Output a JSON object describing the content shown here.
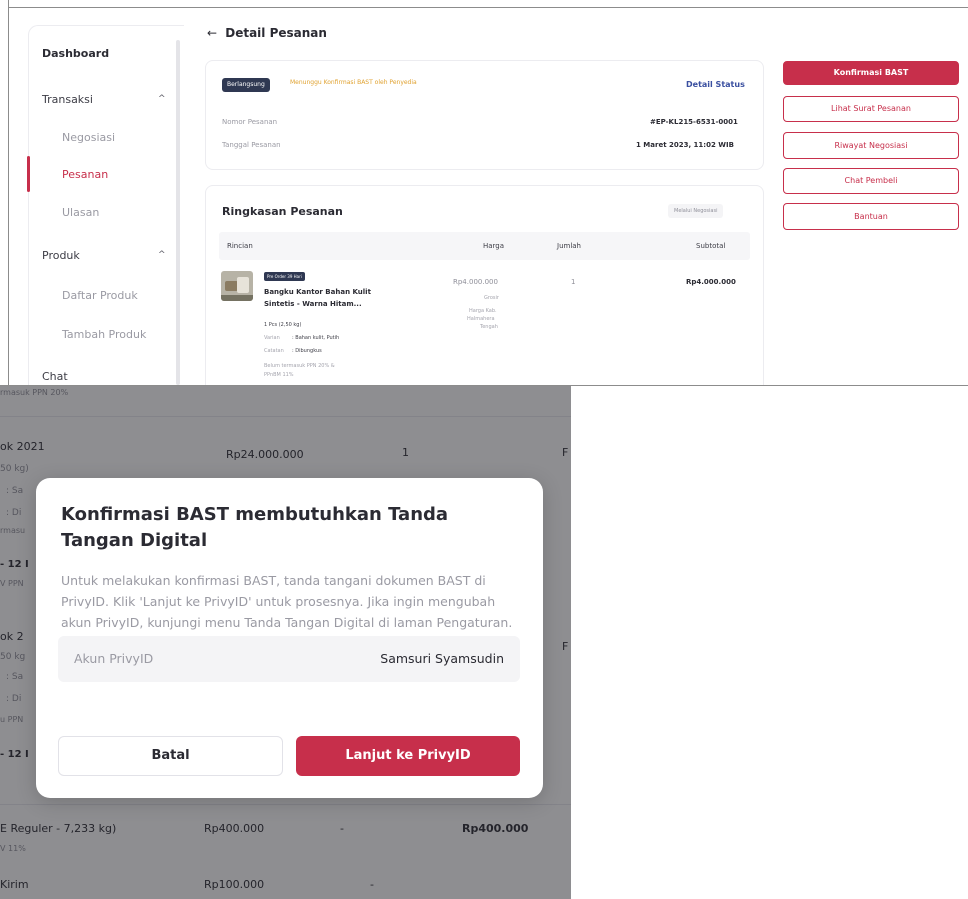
{
  "sidebar": {
    "dashboard": "Dashboard",
    "transaksi": "Transaksi",
    "negosiasi": "Negosiasi",
    "pesanan": "Pesanan",
    "ulasan": "Ulasan",
    "produk": "Produk",
    "daftar_produk": "Daftar Produk",
    "tambah_produk": "Tambah Produk",
    "chat": "Chat",
    "chevron": "^"
  },
  "header": {
    "back_arrow": "←",
    "title": "Detail Pesanan"
  },
  "order": {
    "status_badge": "Berlangsung",
    "status_note": "Menunggu Konfirmasi BAST oleh Penyedia",
    "detail_status_link": "Detail Status",
    "nomor_label": "Nomor Pesanan",
    "nomor_value": "#EP-KL215-6531-0001",
    "tanggal_label": "Tanggal Pesanan",
    "tanggal_value": "1 Maret 2023, 11:02 WIB"
  },
  "summary": {
    "title": "Ringkasan Pesanan",
    "via_badge": "Melalui Negosiasi",
    "columns": {
      "rincian": "Rincian",
      "harga": "Harga",
      "jumlah": "Jumlah",
      "subtotal": "Subtotal"
    },
    "item": {
      "badge": "Pre Order 39 Hari",
      "name_line1": "Bangku Kantor Bahan Kulit",
      "name_line2": "Sintetis - Warna Hitam...",
      "qty_weight": "1 Pcs (2,50 kg)",
      "varian_label": "Varian",
      "varian_value": ": Bahan kulit, Putih",
      "catatan_label": "Catatan",
      "catatan_value": ": Dibungkus",
      "tax_line1": "Belum termasuk PPN 20% &",
      "tax_line2": "PPnBM 11%",
      "price": "Rp4.000.000",
      "grosir": "Grosir",
      "harga_note_1": "Harga Kab.",
      "harga_note_2": "Halmahera",
      "harga_note_3": "Tengah",
      "qty": "1",
      "subtotal": "Rp4.000.000"
    }
  },
  "actions": {
    "konfirmasi": "Konfirmasi BAST",
    "lihat_surat": "Lihat Surat Pesanan",
    "riwayat": "Riwayat Negosiasi",
    "chat": "Chat Pembeli",
    "bantuan": "Bantuan"
  },
  "background_list": {
    "row0_tax": "rmasuk PPN 20%",
    "row1_name": "ok 2021",
    "row1_weight": "50 kg)",
    "row1_price": "Rp24.000.000",
    "row1_qty": "1",
    "row1_s": ": Sa",
    "row1_d": ": Di",
    "row1_tax": "rmasu",
    "row1_12": "- 12 I",
    "row1_ppn": "V PPN",
    "row2_name": "ok 2",
    "row2_weight": "50 kg",
    "row2_s": ": Sa",
    "row2_d": ": Di",
    "row2_ppn": "u PPN",
    "row2_12": "- 12 I",
    "ship_name": "E Reguler - 7,233 kg)",
    "ship_tax": "V 11%",
    "ship_price": "Rp400.000",
    "ship_qty": "-",
    "ship_subtotal": "Rp400.000",
    "kirim_name": "Kirim",
    "kirim_price": "Rp100.000",
    "kirim_qty": "-",
    "edge_r": "F"
  },
  "modal": {
    "title": "Konfirmasi BAST membutuhkan Tanda Tangan Digital",
    "description": "Untuk melakukan konfirmasi BAST, tanda tangani dokumen BAST di PrivyID. Klik 'Lanjut ke PrivyID' untuk prosesnya. Jika ingin mengubah akun PrivyID, kunjungi menu Tanda Tangan Digital di laman Pengaturan.",
    "field_label": "Akun PrivyID",
    "field_value": "Samsuri Syamsudin",
    "cancel": "Batal",
    "confirm": "Lanjut ke PrivyID"
  },
  "colors": {
    "primary": "#c72f4b",
    "badge_dark": "#2f3852",
    "warn": "#e0a230",
    "link": "#3a4fa0"
  }
}
